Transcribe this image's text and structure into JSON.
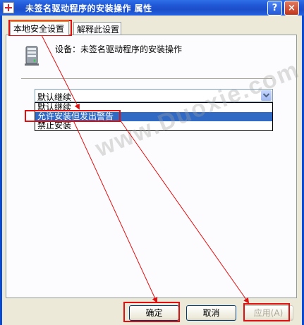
{
  "window": {
    "title": "未签名驱动程序的安装操作 属性",
    "help_label": "?",
    "close_label": "×"
  },
  "tabs": [
    {
      "label": "本地安全设置",
      "active": true
    },
    {
      "label": "解释此设置",
      "active": false
    }
  ],
  "setting": {
    "device_label": "设备：未签名驱动程序的安装操作",
    "selected_value": "默认继续",
    "options": [
      "默认继续",
      "允许安装但发出警告",
      "禁止安装"
    ],
    "highlighted_option_index": 1
  },
  "buttons": {
    "ok": "确定",
    "cancel": "取消",
    "apply": "应用(A)"
  },
  "watermark": "www.Duoxie.com",
  "colors": {
    "accent": "#316ac5",
    "titlebar": "#1f57d6",
    "annotation": "#e01010"
  }
}
